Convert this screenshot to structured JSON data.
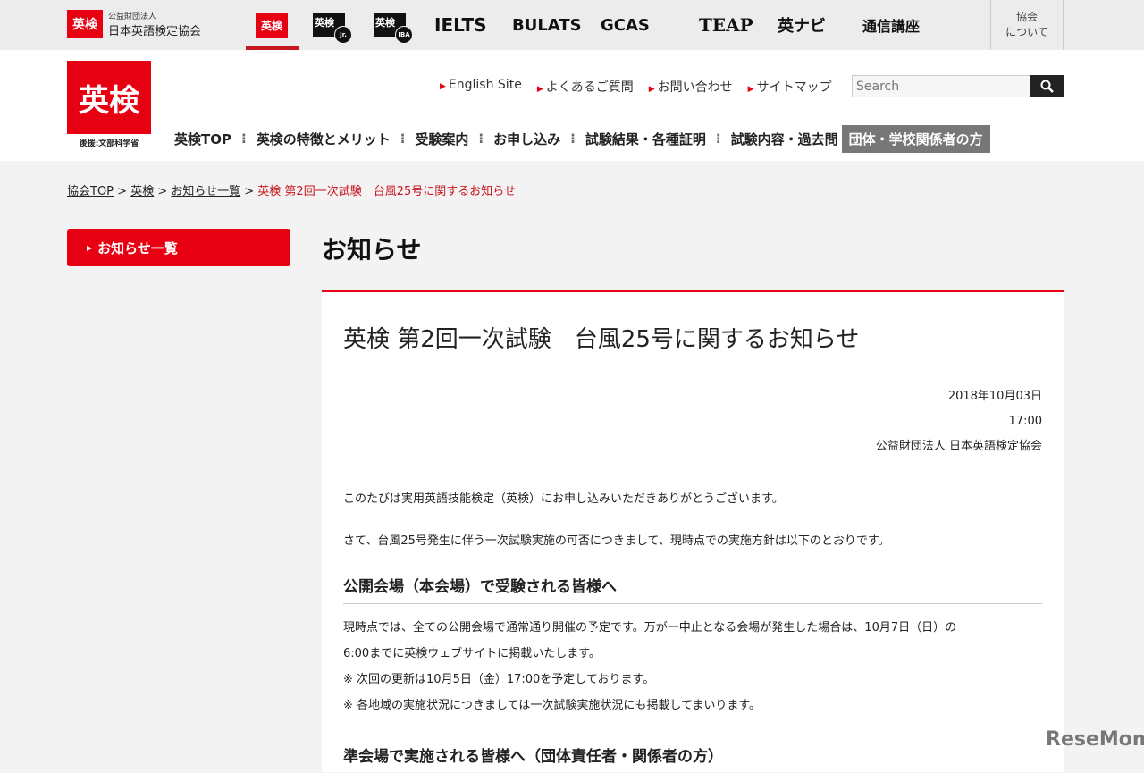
{
  "topbar": {
    "org_mark": "英検",
    "org_small": "公益財団法人",
    "org_name": "日本英語検定協会",
    "brands": [
      {
        "mark": "英検"
      },
      {
        "mark": "英検",
        "badge": "Jr."
      },
      {
        "mark": "英検",
        "badge": "IBA"
      },
      {
        "label": "IELTS"
      },
      {
        "label": "BULATS"
      },
      {
        "label": "GCAS"
      },
      {
        "label": "TEAP"
      },
      {
        "label": "英ナビ"
      },
      {
        "label": "通信講座"
      }
    ],
    "about_1": "協会",
    "about_2": "について"
  },
  "header": {
    "logo": "英検",
    "logo_sub": "後援:文部科学省",
    "utils": [
      "English Site",
      "よくあるご質問",
      "お問い合わせ",
      "サイトマップ"
    ],
    "search_placeholder": "Search",
    "nav": [
      "英検TOP",
      "英検の特徴とメリット",
      "受験案内",
      "お申し込み",
      "試験結果・各種証明",
      "試験内容・過去問"
    ],
    "nav_group": "団体・学校関係者の方"
  },
  "breadcrumb": {
    "items": [
      "協会TOP",
      "英検",
      "お知らせ一覧"
    ],
    "current": "英検 第2回一次試験　台風25号に関するお知らせ"
  },
  "sidebar": {
    "item": "お知らせ一覧"
  },
  "page_title": "お知らせ",
  "article": {
    "title": "英検 第2回一次試験　台風25号に関するお知らせ",
    "date": "2018年10月03日",
    "time": "17:00",
    "author": "公益財団法人 日本英語検定協会",
    "p1": "このたびは実用英語技能検定（英検）にお申し込みいただきありがとうございます。",
    "p2": "さて、台風25号発生に伴う一次試験実施の可否につきまして、現時点での実施方針は以下のとおりです。",
    "h1": "公開会場（本会場）で受験される皆様へ",
    "l1": "現時点では、全ての公開会場で通常通り開催の予定です。万が一中止となる会場が発生した場合は、10月7日（日）の",
    "l2": "6:00までに英検ウェブサイトに掲載いたします。",
    "l3": "※ 次回の更新は10月5日（金）17:00を予定しております。",
    "l4": "※ 各地域の実施状況につきましては一次試験実施状況にも掲載してまいります。",
    "h2": "準会場で実施される皆様へ（団体責任者・関係者の方）"
  },
  "watermark": "ReseMom"
}
